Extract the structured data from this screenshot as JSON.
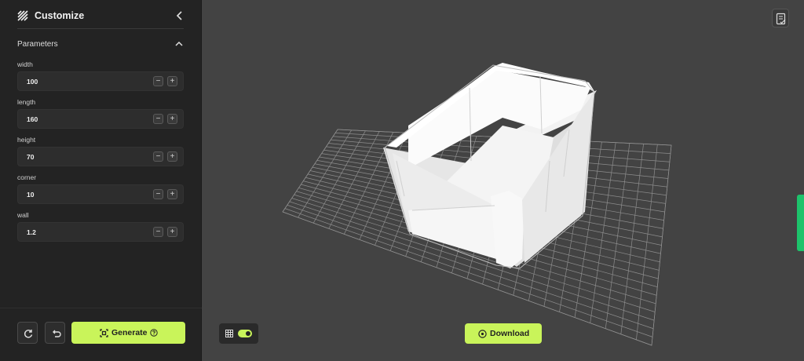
{
  "sidebar": {
    "title": "Customize",
    "section_title": "Parameters",
    "params": [
      {
        "label": "width",
        "value": "100"
      },
      {
        "label": "length",
        "value": "160"
      },
      {
        "label": "height",
        "value": "70"
      },
      {
        "label": "corner",
        "value": "10"
      },
      {
        "label": "wall",
        "value": "1.2"
      }
    ],
    "stepper_minus": "−",
    "stepper_plus": "+",
    "generate_label": "Generate"
  },
  "viewport": {
    "download_label": "Download",
    "grid_toggle_on": true,
    "model": "3D storage bin"
  },
  "colors": {
    "accent": "#c9f45a",
    "sidebar_bg": "#232323",
    "viewport_bg": "#434343",
    "side_tab": "#1dc36b"
  },
  "icons": [
    "pattern-logo-icon",
    "chevron-left-icon",
    "chevron-up-icon",
    "reset-icon",
    "undo-icon",
    "scan-icon",
    "help-icon",
    "notes-icon",
    "grid-icon",
    "download-icon"
  ]
}
